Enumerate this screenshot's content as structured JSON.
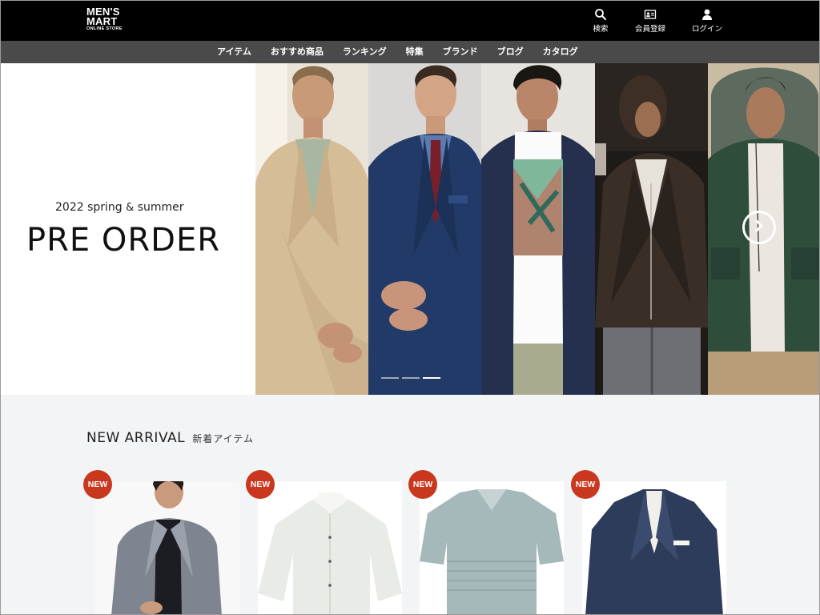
{
  "header": {
    "logo": {
      "line1": "MEN'S",
      "line2": "MART",
      "line3": "ONLINE STORE"
    },
    "search_label": "検索",
    "register_label": "会員登録",
    "login_label": "ログイン"
  },
  "nav": {
    "items": [
      "アイテム",
      "おすすめ商品",
      "ランキング",
      "特集",
      "ブランド",
      "ブログ",
      "カタログ"
    ]
  },
  "hero": {
    "season_year": "2022",
    "season_spring": "spring",
    "season_amp": "&",
    "season_summer": "summer",
    "headline": "PRE ORDER",
    "slide_count": 3,
    "active_slide": 3
  },
  "new_arrival": {
    "title_en": "NEW ARRIVAL",
    "title_ja": "新着アイテム",
    "badge": "NEW",
    "items": [
      {
        "badge": "NEW"
      },
      {
        "badge": "NEW"
      },
      {
        "badge": "NEW"
      },
      {
        "badge": "NEW"
      }
    ]
  },
  "colors": {
    "header_bg": "#000000",
    "nav_bg": "#4a4a4a",
    "badge": "#c9371f",
    "section_bg": "#f3f4f6"
  }
}
